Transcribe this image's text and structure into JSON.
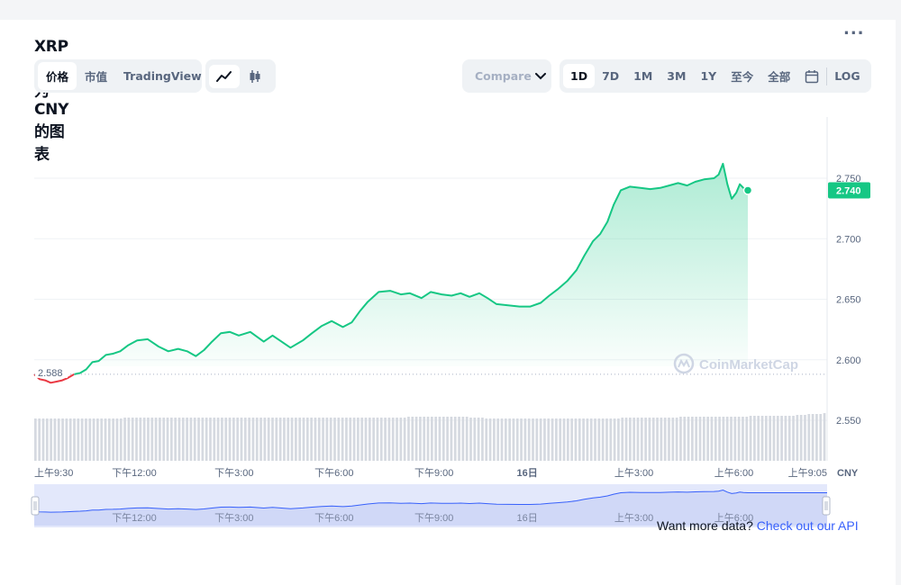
{
  "title": "XRP兑换为CNY的图表",
  "more_label": "...",
  "tabs": [
    {
      "label": "价格",
      "active": true
    },
    {
      "label": "市值",
      "active": false
    },
    {
      "label": "TradingView",
      "active": false
    }
  ],
  "chart_types": [
    {
      "icon": "line-chart-icon",
      "active": true
    },
    {
      "icon": "candlestick-icon",
      "active": false
    }
  ],
  "compare_label": "Compare",
  "ranges": [
    {
      "label": "1D",
      "active": true
    },
    {
      "label": "7D",
      "active": false
    },
    {
      "label": "1M",
      "active": false
    },
    {
      "label": "3M",
      "active": false
    },
    {
      "label": "1Y",
      "active": false
    },
    {
      "label": "至今",
      "active": false
    },
    {
      "label": "全部",
      "active": false
    }
  ],
  "calendar_icon": "calendar-icon",
  "log_label": "LOG",
  "watermark": "CoinMarketCap",
  "footer": {
    "text": "Want more data?",
    "link": "Check out our API"
  },
  "colors": {
    "up": "#16c784",
    "down": "#ea3943",
    "accent": "#3861fb"
  },
  "chart_data": {
    "type": "area",
    "title": "XRP兑换为CNY的图表",
    "currency": "CNY",
    "open_price": 2.588,
    "open_label": "2.588",
    "current_price": 2.74,
    "current_label": "2.740",
    "ylim": [
      2.52,
      2.8
    ],
    "y_ticks": [
      {
        "value": 2.75,
        "label": "2.750"
      },
      {
        "value": 2.7,
        "label": "2.700"
      },
      {
        "value": 2.65,
        "label": "2.650"
      },
      {
        "value": 2.6,
        "label": "2.600"
      },
      {
        "value": 2.55,
        "label": "2.550"
      }
    ],
    "x_ticks": [
      {
        "t": 0,
        "label": "上午9:30",
        "bold": false
      },
      {
        "t": 0.1261,
        "label": "下午12:00",
        "bold": false
      },
      {
        "t": 0.2521,
        "label": "下午3:00",
        "bold": false
      },
      {
        "t": 0.3782,
        "label": "下午6:00",
        "bold": false
      },
      {
        "t": 0.5042,
        "label": "下午9:00",
        "bold": false
      },
      {
        "t": 0.6218,
        "label": "16日",
        "bold": true
      },
      {
        "t": 0.7563,
        "label": "上午3:00",
        "bold": false
      },
      {
        "t": 0.8824,
        "label": "上午6:00",
        "bold": false
      },
      {
        "t": 1.0,
        "label": "上午9:05",
        "bold": false
      }
    ],
    "nav_ticks": [
      {
        "t": 0.1261,
        "label": "下午12:00"
      },
      {
        "t": 0.2521,
        "label": "下午3:00"
      },
      {
        "t": 0.3782,
        "label": "下午6:00"
      },
      {
        "t": 0.5042,
        "label": "下午9:00"
      },
      {
        "t": 0.6218,
        "label": "16日"
      },
      {
        "t": 0.7563,
        "label": "上午3:00"
      },
      {
        "t": 0.8824,
        "label": "上午6:00"
      }
    ],
    "series": [
      {
        "values": [
          [
            0,
            2.588
          ],
          [
            0.0067,
            2.584
          ],
          [
            0.0137,
            2.583
          ],
          [
            0.0208,
            2.581
          ],
          [
            0.0282,
            2.582
          ],
          [
            0.0353,
            2.583
          ],
          [
            0.0425,
            2.585
          ],
          [
            0.0502,
            2.588
          ],
          [
            0.0578,
            2.589
          ],
          [
            0.0655,
            2.592
          ],
          [
            0.0733,
            2.598
          ],
          [
            0.0812,
            2.599
          ],
          [
            0.0903,
            2.604
          ],
          [
            0.0993,
            2.605
          ],
          [
            0.1084,
            2.607
          ],
          [
            0.1185,
            2.612
          ],
          [
            0.1298,
            2.616
          ],
          [
            0.1432,
            2.617
          ],
          [
            0.1567,
            2.611
          ],
          [
            0.1691,
            2.607
          ],
          [
            0.1815,
            2.609
          ],
          [
            0.1928,
            2.607
          ],
          [
            0.2039,
            2.603
          ],
          [
            0.2141,
            2.608
          ],
          [
            0.2242,
            2.615
          ],
          [
            0.2354,
            2.622
          ],
          [
            0.2467,
            2.623
          ],
          [
            0.2579,
            2.62
          ],
          [
            0.2725,
            2.623
          ],
          [
            0.2894,
            2.615
          ],
          [
            0.3006,
            2.62
          ],
          [
            0.3119,
            2.615
          ],
          [
            0.3232,
            2.61
          ],
          [
            0.3389,
            2.616
          ],
          [
            0.3503,
            2.622
          ],
          [
            0.3627,
            2.628
          ],
          [
            0.3752,
            2.632
          ],
          [
            0.3892,
            2.627
          ],
          [
            0.4006,
            2.631
          ],
          [
            0.4106,
            2.64
          ],
          [
            0.4208,
            2.648
          ],
          [
            0.4344,
            2.656
          ],
          [
            0.4489,
            2.657
          ],
          [
            0.4624,
            2.654
          ],
          [
            0.4737,
            2.655
          ],
          [
            0.4884,
            2.651
          ],
          [
            0.5,
            2.656
          ],
          [
            0.5139,
            2.654
          ],
          [
            0.5264,
            2.653
          ],
          [
            0.5377,
            2.655
          ],
          [
            0.549,
            2.652
          ],
          [
            0.5614,
            2.655
          ],
          [
            0.5716,
            2.651
          ],
          [
            0.5831,
            2.646
          ],
          [
            0.5976,
            2.645
          ],
          [
            0.6122,
            2.644
          ],
          [
            0.6257,
            2.644
          ],
          [
            0.6388,
            2.647
          ],
          [
            0.6496,
            2.653
          ],
          [
            0.6598,
            2.658
          ],
          [
            0.6722,
            2.665
          ],
          [
            0.6839,
            2.674
          ],
          [
            0.6937,
            2.686
          ],
          [
            0.7048,
            2.698
          ],
          [
            0.7139,
            2.704
          ],
          [
            0.7229,
            2.714
          ],
          [
            0.7308,
            2.728
          ],
          [
            0.7398,
            2.74
          ],
          [
            0.7511,
            2.743
          ],
          [
            0.7646,
            2.742
          ],
          [
            0.7769,
            2.741
          ],
          [
            0.7894,
            2.742
          ],
          [
            0.8008,
            2.744
          ],
          [
            0.8121,
            2.746
          ],
          [
            0.8234,
            2.744
          ],
          [
            0.8336,
            2.747
          ],
          [
            0.8449,
            2.749
          ],
          [
            0.8574,
            2.75
          ],
          [
            0.8632,
            2.753
          ],
          [
            0.8686,
            2.762
          ],
          [
            0.8742,
            2.745
          ],
          [
            0.8797,
            2.733
          ],
          [
            0.8854,
            2.738
          ],
          [
            0.8899,
            2.745
          ],
          [
            0.8944,
            2.742
          ],
          [
            0.9,
            2.74
          ]
        ]
      }
    ],
    "volume_values": [
      0.47,
      0.47,
      0.47,
      0.47,
      0.47,
      0.47,
      0.47,
      0.47,
      0.47,
      0.47,
      0.47,
      0.47,
      0.47,
      0.47,
      0.47,
      0.47,
      0.47,
      0.47,
      0.47,
      0.47,
      0.47,
      0.47,
      0.47,
      0.48,
      0.48,
      0.48,
      0.48,
      0.48,
      0.48,
      0.48,
      0.48,
      0.48,
      0.48,
      0.48,
      0.48,
      0.48,
      0.48,
      0.48,
      0.48,
      0.48,
      0.48,
      0.48,
      0.48,
      0.48,
      0.48,
      0.48,
      0.48,
      0.48,
      0.48,
      0.48,
      0.48,
      0.48,
      0.48,
      0.48,
      0.48,
      0.48,
      0.48,
      0.48,
      0.48,
      0.48,
      0.48,
      0.48,
      0.48,
      0.48,
      0.48,
      0.48,
      0.48,
      0.48,
      0.48,
      0.48,
      0.48,
      0.48,
      0.48,
      0.48,
      0.48,
      0.48,
      0.48,
      0.48,
      0.48,
      0.48,
      0.48,
      0.48,
      0.48,
      0.48,
      0.48,
      0.48,
      0.48,
      0.48,
      0.48,
      0.48,
      0.48,
      0.48,
      0.48,
      0.48,
      0.48,
      0.48,
      0.49,
      0.49,
      0.49,
      0.49,
      0.49,
      0.49,
      0.49,
      0.49,
      0.49,
      0.49,
      0.49,
      0.49,
      0.49,
      0.49,
      0.49,
      0.49,
      0.48,
      0.48,
      0.48,
      0.48,
      0.47,
      0.47,
      0.47,
      0.47,
      0.47,
      0.47,
      0.47,
      0.47,
      0.47,
      0.47,
      0.47,
      0.47,
      0.47,
      0.47,
      0.47,
      0.47,
      0.47,
      0.47,
      0.47,
      0.47,
      0.47,
      0.47,
      0.47,
      0.47,
      0.47,
      0.47,
      0.47,
      0.47,
      0.47,
      0.47,
      0.47,
      0.47,
      0.47,
      0.47,
      0.47,
      0.48,
      0.48,
      0.48,
      0.48,
      0.48,
      0.48,
      0.48,
      0.48,
      0.48,
      0.48,
      0.48,
      0.48,
      0.48,
      0.48,
      0.48,
      0.49,
      0.49,
      0.49,
      0.49,
      0.49,
      0.49,
      0.49,
      0.49,
      0.49,
      0.49,
      0.49,
      0.49,
      0.49,
      0.49,
      0.49,
      0.49,
      0.49,
      0.49,
      0.5,
      0.5,
      0.5,
      0.5,
      0.5,
      0.5,
      0.5,
      0.5,
      0.5,
      0.5,
      0.5,
      0.5,
      0.51,
      0.51,
      0.51,
      0.52,
      0.52,
      0.52,
      0.52,
      0.53
    ]
  }
}
